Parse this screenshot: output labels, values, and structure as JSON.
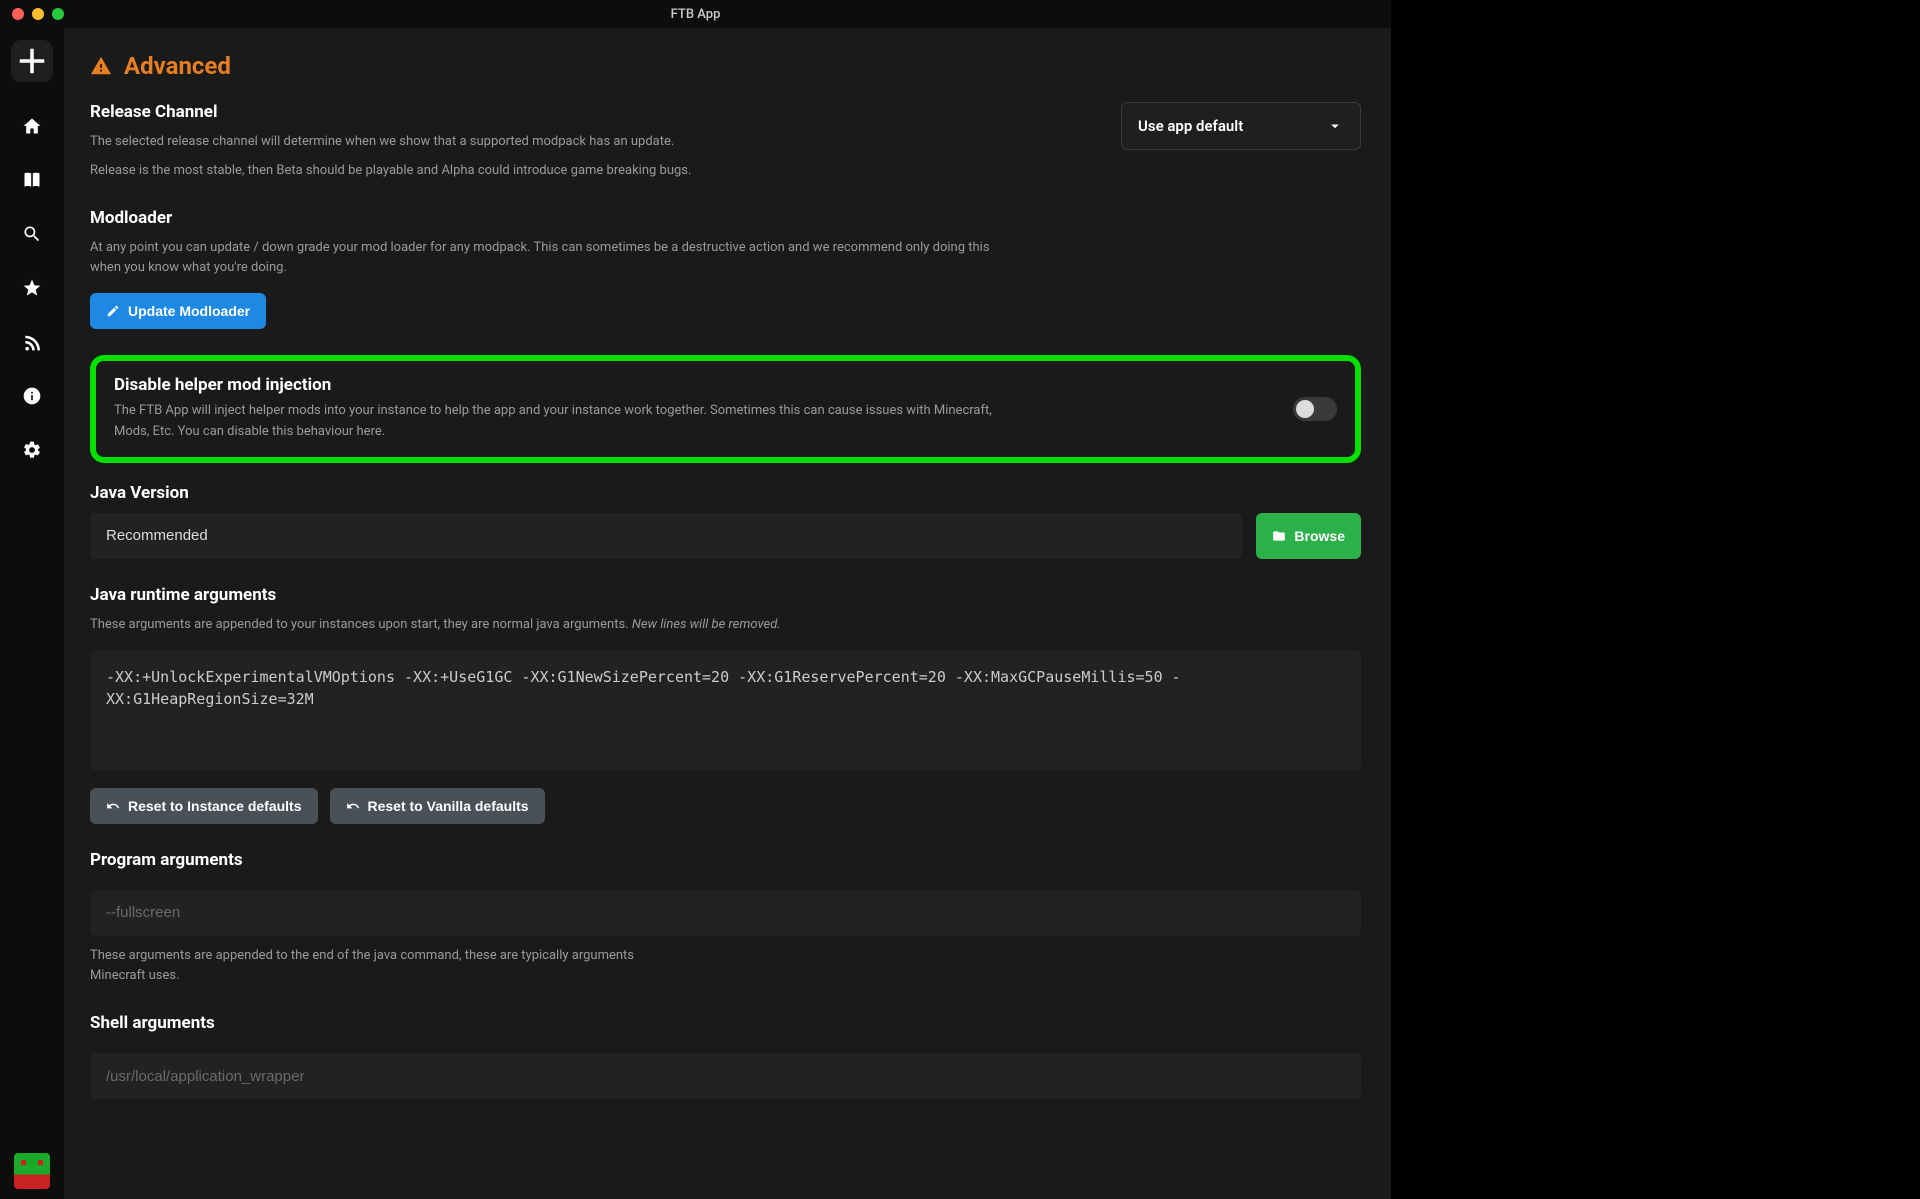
{
  "titlebar": {
    "title": "FTB App"
  },
  "page": {
    "title": "Advanced"
  },
  "release": {
    "title": "Release Channel",
    "desc1": "The selected release channel will determine when we show that a supported modpack has an update.",
    "desc2": "Release is the most stable, then Beta should be playable and Alpha could introduce game breaking bugs.",
    "dropdown_value": "Use app default"
  },
  "modloader": {
    "title": "Modloader",
    "desc": "At any point you can update / down grade your mod loader for any modpack. This can sometimes be a destructive action and we recommend only doing this when you know what you're doing.",
    "button": "Update Modloader"
  },
  "disable_helper": {
    "title": "Disable helper mod injection",
    "desc": "The FTB App will inject helper mods into your instance to help the app and your instance work together. Sometimes this can cause issues with Minecraft, Mods, Etc. You can disable this behaviour here."
  },
  "java": {
    "title": "Java Version",
    "value": "Recommended",
    "browse": "Browse"
  },
  "runtime_args": {
    "title": "Java runtime arguments",
    "desc_a": "These arguments are appended to your instances upon start, they are normal java arguments. ",
    "desc_b": "New lines will be removed.",
    "value": "-XX:+UnlockExperimentalVMOptions -XX:+UseG1GC -XX:G1NewSizePercent=20 -XX:G1ReservePercent=20 -XX:MaxGCPauseMillis=50 -XX:G1HeapRegionSize=32M",
    "reset_instance": "Reset to Instance defaults",
    "reset_vanilla": "Reset to Vanilla defaults"
  },
  "program_args": {
    "title": "Program arguments",
    "placeholder": "--fullscreen",
    "desc": "These arguments are appended to the end of the java command, these are typically arguments Minecraft uses."
  },
  "shell_args": {
    "title": "Shell arguments",
    "placeholder": "/usr/local/application_wrapper"
  }
}
